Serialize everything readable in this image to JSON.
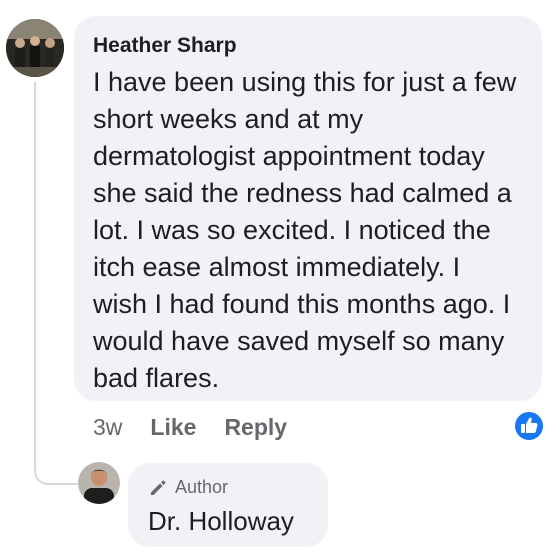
{
  "comment": {
    "author": "Heather Sharp",
    "text_lines": [
      "I have been using this for just a few",
      "short weeks and at my",
      "dermatologist appointment today",
      "she said the redness had calmed a",
      "lot. I was so excited. I noticed the",
      "itch ease almost immediately. I",
      "wish I had found this months ago. I",
      "would have saved myself so many",
      "bad flares."
    ],
    "timestamp": "3w",
    "like_label": "Like",
    "reply_label": "Reply",
    "reaction_icon": "thumbs-up-icon",
    "reaction_color": "#1877f2"
  },
  "reply": {
    "badge_icon": "pencil-icon",
    "badge_label": "Author",
    "author": "Dr. Holloway"
  },
  "colors": {
    "bubble": "#f0f2f5",
    "text": "#1c1e21",
    "secondary": "#65676b",
    "thread_line": "#d6d8dc"
  }
}
